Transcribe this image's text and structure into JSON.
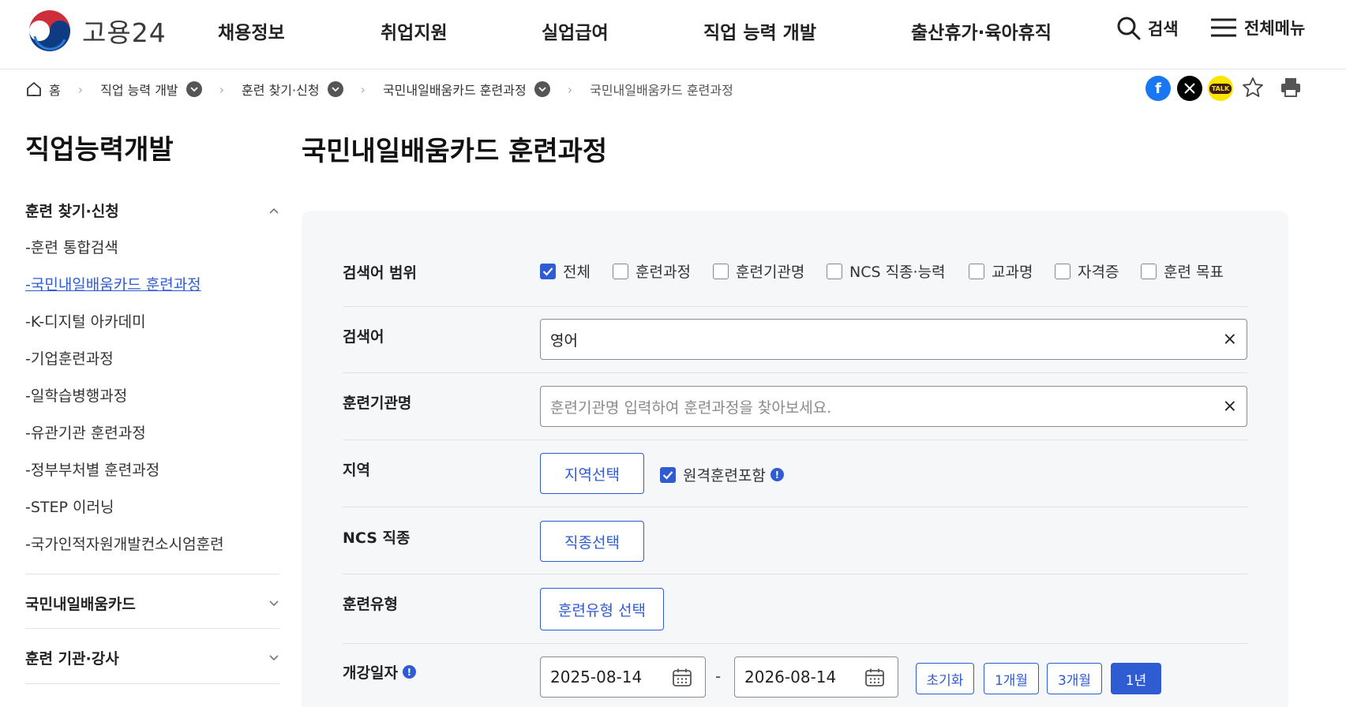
{
  "header": {
    "logo_text": "고용24",
    "nav": [
      "채용정보",
      "취업지원",
      "실업급여",
      "직업 능력 개발",
      "출산휴가·육아휴직"
    ],
    "search_label": "검색",
    "menu_label": "전체메뉴"
  },
  "breadcrumb": [
    "홈",
    "직업 능력 개발",
    "훈련 찾기·신청",
    "국민내일배움카드 훈련과정",
    "국민내일배움카드 훈련과정"
  ],
  "share": {
    "kakao_label": "TALK"
  },
  "sidebar": {
    "title": "직업능력개발",
    "group1": "훈련 찾기·신청",
    "items": [
      "-훈련 통합검색",
      "-국민내일배움카드 훈련과정",
      "-K-디지털 아카데미",
      "-기업훈련과정",
      "-일학습병행과정",
      "-유관기관 훈련과정",
      "-정부부처별 훈련과정",
      "-STEP 이러닝",
      "-국가인적자원개발컨소시엄훈련"
    ],
    "group2": "국민내일배움카드",
    "group3": "훈련 기관·강사"
  },
  "main": {
    "title": "국민내일배움카드 훈련과정",
    "scope_label": "검색어 범위",
    "scope_options": [
      "전체",
      "훈련과정",
      "훈련기관명",
      "NCS 직종·능력",
      "교과명",
      "자격증",
      "훈련 목표"
    ],
    "keyword_label": "검색어",
    "keyword_value": "영어",
    "institution_label": "훈련기관명",
    "institution_placeholder": "훈련기관명 입력하여 훈련과정을 찾아보세요.",
    "region_label": "지역",
    "region_button": "지역선택",
    "remote_label": "원격훈련포함",
    "ncs_label": "NCS 직종",
    "ncs_button": "직종선택",
    "type_label": "훈련유형",
    "type_button": "훈련유형 선택",
    "date_label": "개강일자",
    "date_start": "2025-08-14",
    "date_sep": "-",
    "date_end": "2026-08-14",
    "period_buttons": [
      "초기화",
      "1개월",
      "3개월",
      "1년"
    ],
    "info_mark": "!",
    "clear_mark": "×"
  }
}
